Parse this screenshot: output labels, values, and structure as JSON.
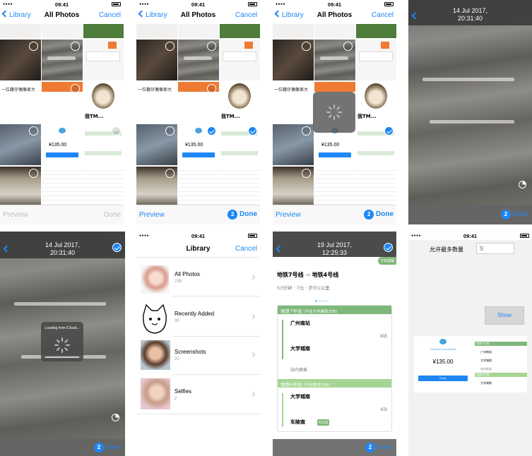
{
  "status": {
    "time": "09:41"
  },
  "picker": {
    "back_label": "Library",
    "title": "All Photos",
    "cancel_label": "Cancel",
    "preview_label": "Preview",
    "done_label": "Done",
    "selected_count": "2",
    "thumb_text": {
      "meme_caption": "我TM...",
      "price": "¥135.00",
      "promo": "一位籍仔偶像家大"
    }
  },
  "viewer": {
    "date": "14 Jul 2017,",
    "time": "20:31:40",
    "done_label": "Done",
    "count": "2",
    "loading_label": "Loading from iCloud..."
  },
  "library": {
    "title": "Library",
    "cancel_label": "Cancel",
    "albums": [
      {
        "name": "All Photos",
        "count": "236"
      },
      {
        "name": "Recently Added",
        "count": "35"
      },
      {
        "name": "Screenshots",
        "count": "20"
      },
      {
        "name": "Selfies",
        "count": "2"
      }
    ]
  },
  "transit": {
    "date": "19 Jul 2017,",
    "time": "12:25:33",
    "route_from": "地铁7号线",
    "route_to": "地铁4号线",
    "summary": "53分钟 · 7元 · 步行1公里",
    "line1": "地铁7号线",
    "line1_dir": "(开往大学城南方向)",
    "stop1": "广州南站",
    "stop1_count": "8站",
    "stop2": "大学城南",
    "transfer": "站内换乘",
    "line2": "地铁4号线",
    "line2_dir": "(开往黄村方向)",
    "stop3": "大学城南",
    "stop3_count": "4站",
    "stop4": "车陂南",
    "stop4_tag": "A口出",
    "done_label": "Done",
    "count": "2",
    "corner_tag": "下车提醒"
  },
  "settings": {
    "max_label": "允许最多数量",
    "max_placeholder": "9",
    "show_label": "Show",
    "receipt_title": "Payment Successful",
    "receipt_price": "¥135.00",
    "receipt_done": "Done",
    "route_a": "地铁7号线",
    "route_b": "地铁4号线",
    "stop_a": "广州南站",
    "stop_b": "大学城南",
    "transfer": "站内换乘",
    "stop_c": "大学城南"
  },
  "colors": {
    "accent": "#1e86f5",
    "line_green": "#7fb87a",
    "line_tint": "#e6f3e4",
    "orange": "#ef7a34"
  }
}
